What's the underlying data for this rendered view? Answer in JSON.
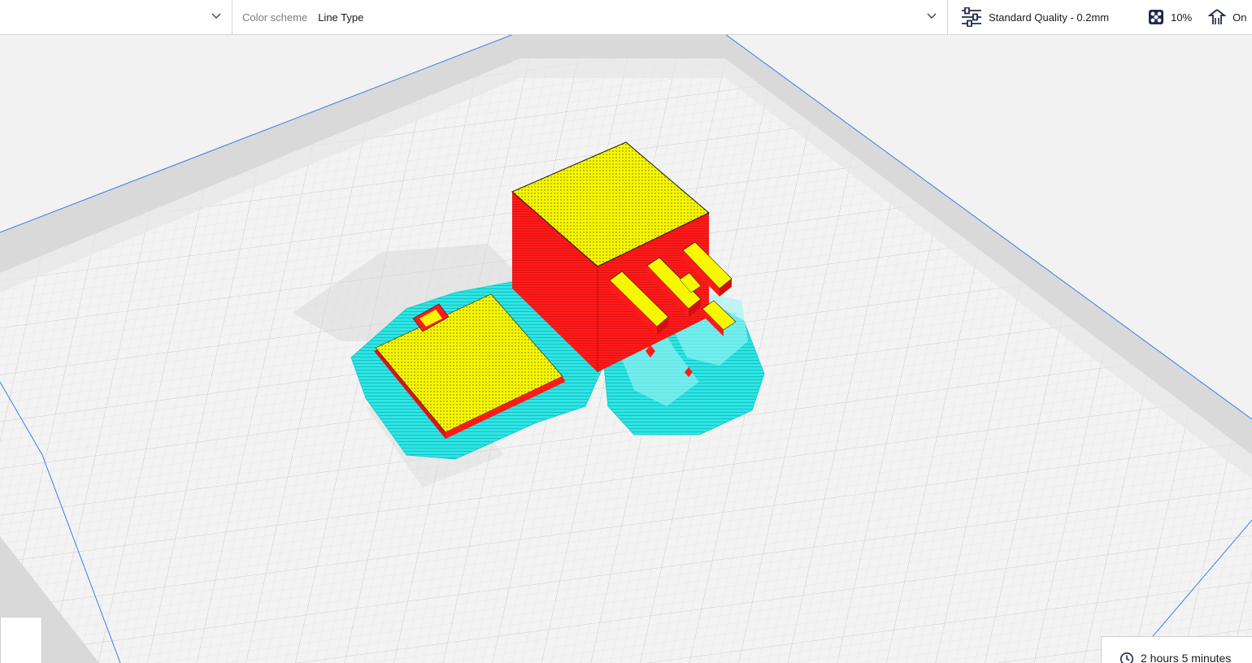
{
  "toolbar": {
    "color_scheme_label": "Color scheme",
    "color_scheme_value": "Line Type",
    "profile_label": "Standard Quality - 0.2mm",
    "infill_value": "10%",
    "support_label": "On",
    "icons": {
      "left_dropdown": "chevron-down-icon",
      "scheme_dropdown": "chevron-down-icon",
      "profile": "sliders-icon",
      "infill": "infill-icon",
      "support": "support-icon"
    }
  },
  "estimate": {
    "print_time": "2 hours 5 minutes",
    "icon": "clock-icon"
  },
  "colors": {
    "infill": "#f7f700",
    "wall": "#ff1a1a",
    "support": "#29e3e3",
    "build_plate": "#f2f2f2",
    "accent_edge": "#3d7be8"
  }
}
